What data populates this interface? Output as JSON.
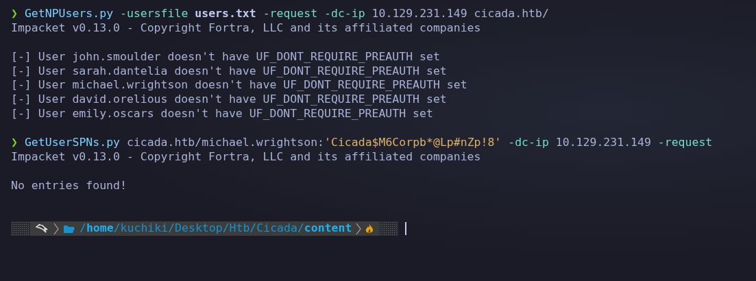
{
  "blocks": [
    {
      "prompt": "❯",
      "command": [
        {
          "kind": "program",
          "text": "GetNPUsers.py"
        },
        {
          "kind": "flag",
          "text": " -usersfile"
        },
        {
          "kind": "bold",
          "text": " users.txt"
        },
        {
          "kind": "flag",
          "text": " -request"
        },
        {
          "kind": "flag",
          "text": " -dc-ip"
        },
        {
          "kind": "plain",
          "text": " 10.129.231.149 cicada.htb/"
        }
      ],
      "output_groups": [
        [
          "Impacket v0.13.0 - Copyright Fortra, LLC and its affiliated companies"
        ],
        [
          "[-] User john.smoulder doesn't have UF_DONT_REQUIRE_PREAUTH set",
          "[-] User sarah.dantelia doesn't have UF_DONT_REQUIRE_PREAUTH set",
          "[-] User michael.wrightson doesn't have UF_DONT_REQUIRE_PREAUTH set",
          "[-] User david.orelious doesn't have UF_DONT_REQUIRE_PREAUTH set",
          "[-] User emily.oscars doesn't have UF_DONT_REQUIRE_PREAUTH set"
        ]
      ]
    },
    {
      "prompt": "❯",
      "command": [
        {
          "kind": "program",
          "text": "GetUserSPNs.py"
        },
        {
          "kind": "plain",
          "text": " cicada.htb/michael.wrightson:"
        },
        {
          "kind": "string",
          "text": "'Cicada$M6Corpb*@Lp#nZp!8'"
        },
        {
          "kind": "flag",
          "text": " -dc-ip"
        },
        {
          "kind": "plain",
          "text": " 10.129.231.149"
        },
        {
          "kind": "flag",
          "text": " -request"
        }
      ],
      "output_groups": [
        [
          "Impacket v0.13.0 - Copyright Fortra, LLC and its affiliated companies"
        ],
        [
          "No entries found!"
        ]
      ]
    }
  ],
  "prompt_bar": {
    "path": "/**home**/kuchiki/Desktop/Htb/Cicada/**content**"
  }
}
